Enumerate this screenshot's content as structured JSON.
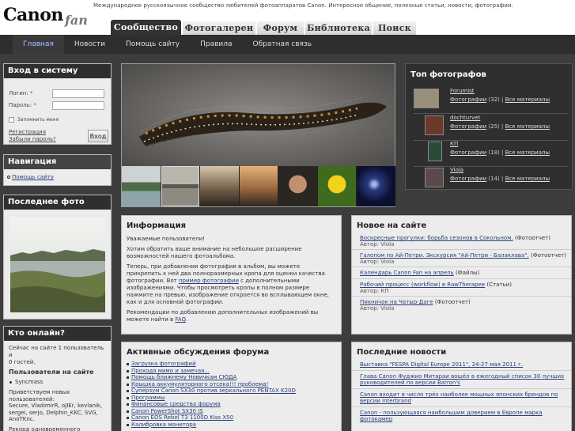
{
  "header": {
    "logo_main": "Canon",
    "logo_sub": "fan",
    "tagline": "Международное русскоязычное сообщество любителей фотоаппаратов Canon. Интересное общение, полезные статьи, новости, фотографии.",
    "tabs": [
      "Сообщество",
      "Фотогалереи",
      "Форум",
      "Библиотека",
      "Поиск"
    ],
    "active_tab": "Сообщество"
  },
  "subnav": [
    "Главная",
    "Новости",
    "Помощь сайту",
    "Правила",
    "Обратная связь"
  ],
  "login": {
    "title": "Вход в систему",
    "login_label": "Логин:",
    "password_label": "Пароль:",
    "required_mark": "*",
    "remember_label": "Запомнить меня",
    "register_link": "Регистрация",
    "forgot_link": "Забыли пароль?",
    "submit": "Вход"
  },
  "navigation": {
    "title": "Навигация",
    "items": [
      "Помощь сайту"
    ]
  },
  "last_photo": {
    "title": "Последнее фото"
  },
  "online": {
    "title": "Кто онлайн?",
    "summary_line1": "Сейчас на сайте 1 пользователь и",
    "summary_line2": "0 гостей.",
    "users_title": "Пользователи на сайте",
    "users": [
      "Syncmass"
    ],
    "greeting_title": "Приветствуем новых пользователей:",
    "new_users": "Secure, VladimirR, oJIEr, kevlanik, sergei, serjo, Delphin_KKC, SVG, AnoTKnc.",
    "record_line": "Рекорд одновременного"
  },
  "info": {
    "title": "Информация",
    "p1": "Уважаемые пользователи!",
    "p2": "Хотим обратить ваше внимание на небольшое расширение возможностей нашего фотоальбома.",
    "p3_before": "Теперь, при добавлении фотографии в альбом, вы можете прикрепить к ней два полноразмерных кропа для оценки качества фотографии. Вот ",
    "p3_link": "пример фотографии",
    "p3_after": " с дополнительными изображениями. Чтобы просмотреть кропы в полном размере нажмите на превью, изображение откроется во всплывающем окне, как и для основной фотографии.",
    "p4_before": "Рекомендации по добавлению дополнительных изображений вы можете найти в ",
    "p4_link": "FAQ",
    "p4_after": "."
  },
  "forum": {
    "title": "Активные обсуждения форума",
    "topics": [
      "Загрузка фотографий",
      "Проходя мимо и замечая...",
      "Помощь ближнему Новичкам СЮДА",
      "Крышка аккумуляторного отсека!!! проблема!",
      "Суперзум Canon SX30 против зеркального PENTAX K20D",
      "Программы",
      "Финансовые средства форума",
      "Canon PowerShot SX30 IS",
      "Canon EOS Rebel T3 1100D Kiss X50",
      "Калибровка монитора"
    ]
  },
  "top_photographers": {
    "title": "Топ фотографов",
    "photos_label": "Фотографии",
    "all_label": "Все материалы",
    "items": [
      {
        "name": "Forumist",
        "count": "(32)",
        "color": "#9a8f7a"
      },
      {
        "name": "dochturvet",
        "count": "(25)",
        "color": "#6b3a2a"
      },
      {
        "name": "КП",
        "count": "(18)",
        "color": "#2a4a3a"
      },
      {
        "name": "Viola",
        "count": "(14)",
        "color": "#5a4a4a"
      }
    ]
  },
  "new_on_site": {
    "title": "Новое на сайте",
    "items": [
      {
        "link": "Воскресные прогулки: борьба сезонов в Сокольном.",
        "type": " (Фотоотчет)",
        "author": "Автор: Viola"
      },
      {
        "link": "Галопом по Ай-Петри. Экскурсия \"Ай-Петри - Балаклава\".",
        "type": " (Фотоотчет)",
        "author": "Автор: Viola"
      },
      {
        "link": "Календарь Canon Fan на апрель",
        "type": " (Файлы)",
        "author": ""
      },
      {
        "link": "Рабочий процесс (workflow) в RawTherapee",
        "type": " (Статьи)",
        "author": "Автор: КП"
      },
      {
        "link": "Пикничок на Чатыр-Даге",
        "type": " (Фотоотчет)",
        "author": "Автор: Viola"
      }
    ]
  },
  "news": {
    "title": "Последние новости",
    "items": [
      "Выставка \"FESPA Digital Europe 2011\", 24-27 мая 2011 г.",
      "Глава Canon Фуджио Митараи вошёл в ежегодный список 30 лучших руководителей по версии Barron's",
      "Canon входит в число трёх наиболее мощных японских брендов по версии Interbrand",
      "Canon - пользующаяся наибольшим доверием в Европе марка фотокамер"
    ]
  }
}
